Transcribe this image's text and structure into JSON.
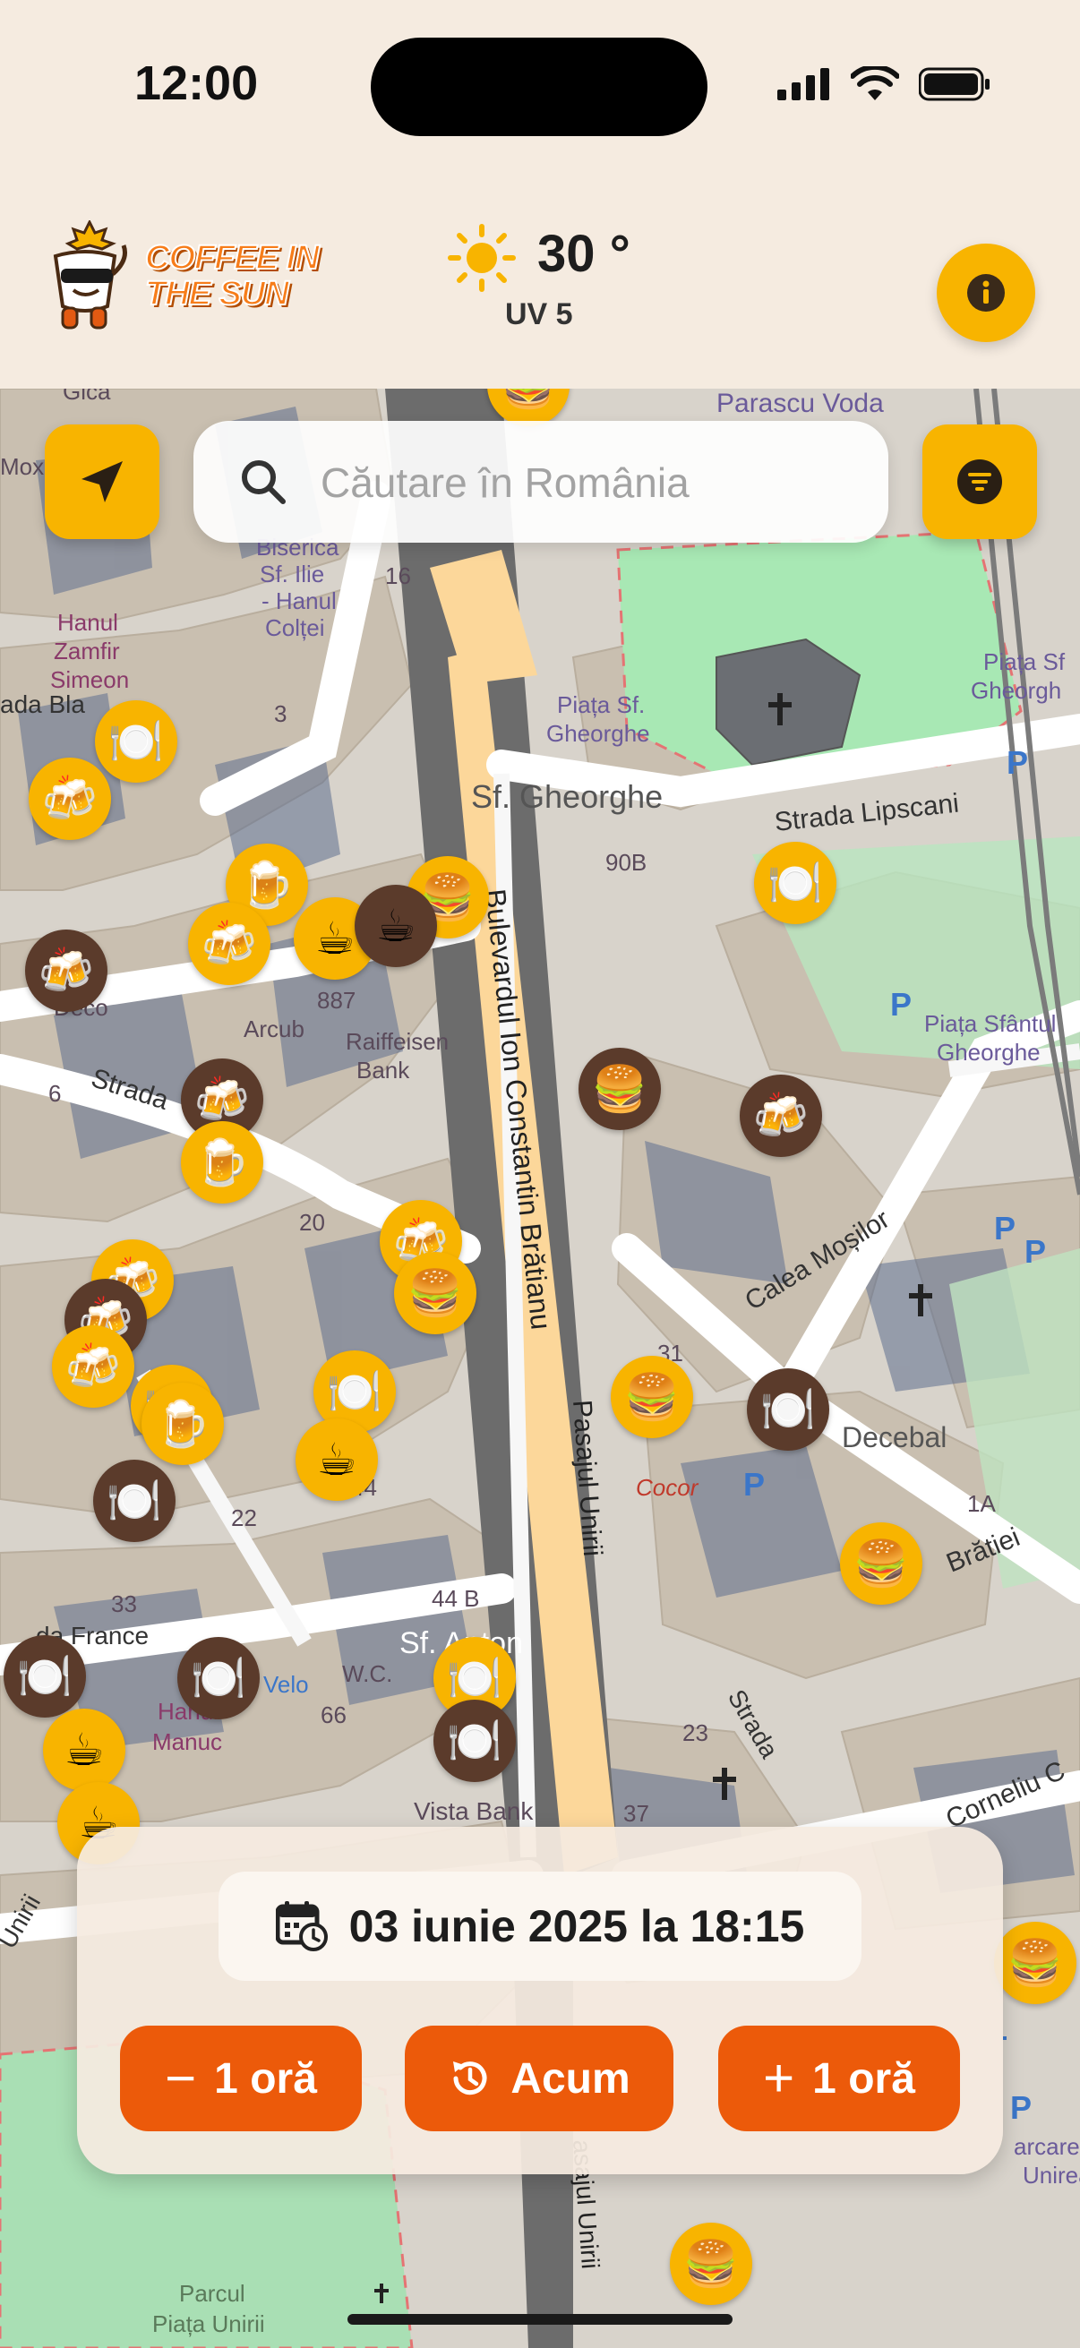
{
  "status_bar": {
    "time": "12:00"
  },
  "header": {
    "logo_line1": "COFFEE IN",
    "logo_line2": "THE SUN",
    "temperature": "30 °",
    "uv": "UV 5"
  },
  "search": {
    "placeholder": "Căutare în România"
  },
  "map_labels": {
    "biserica": [
      "Biserica",
      "Sf. Ilie",
      "- Hanul",
      "Colței"
    ],
    "hanul": [
      "Hanul",
      "Zamfir",
      "Simeon"
    ],
    "piata_sf_gheorghe": [
      "Piața Sf.",
      "Gheorghe"
    ],
    "sf_gheorghe": "Sf. Gheorghe",
    "strada_lipscani": "Strada Lipscani",
    "piata_sf_right": [
      "Piața Sf",
      "Gheorgh"
    ],
    "piata_sfantul": [
      "Piața Sfântul",
      "Gheorghe"
    ],
    "bulevardul": "Bulevardul Ion Constantin Brătianu",
    "raiffeisen": [
      "Raiffeisen",
      "Bank"
    ],
    "deco": "Deco",
    "arcub": "Arcub",
    "strada": "Strada",
    "calea_mosilor": "Calea Moșilor",
    "decebal": "Decebal",
    "cocor": "Cocor",
    "pasajul_unirii": "Pasajul Unirii",
    "bratiei": "Brătiei",
    "sf_anton": "Sf. Anton",
    "hanul_manuc": [
      "Hanul",
      "Manuc"
    ],
    "vista_bank": "Vista Bank",
    "corneliu": "Corneliu C",
    "strada_blanari": "ada Bla",
    "strada_franceza": "da France",
    "unirii_left": "Unirii",
    "piata_unirea": [
      "arcare",
      "Unirea"
    ],
    "parcul": [
      "Parcul",
      "Piața Unirii"
    ],
    "pasajul_bottom": "asajul Unirii",
    "moxa": "Mox",
    "gica": "Gica",
    "parascu": "Parascu Voda",
    "n90b": "90B",
    "n887": "887",
    "n20": "20",
    "n31": "31",
    "n22": "22",
    "n44": "44",
    "n44b": "44 B",
    "n66": "66",
    "n33": "33",
    "n23": "23",
    "n37": "37",
    "n1a": "1A",
    "n3": "3",
    "n6": "6",
    "n16": "16",
    "wc": "W.C.",
    "velo": "Velo"
  },
  "pins": [
    {
      "icon": "🍔",
      "status": "sun"
    },
    {
      "icon": "🍽️",
      "status": "sun"
    },
    {
      "icon": "🍻",
      "status": "sun"
    },
    {
      "icon": "🍺",
      "status": "sun"
    },
    {
      "icon": "🍔",
      "status": "sun"
    },
    {
      "icon": "☕",
      "status": "sun"
    },
    {
      "icon": "☕",
      "status": "shade"
    },
    {
      "icon": "🍻",
      "status": "sun"
    },
    {
      "icon": "🍻",
      "status": "shade"
    },
    {
      "icon": "🍽️",
      "status": "sun"
    },
    {
      "icon": "🍔",
      "status": "shade"
    },
    {
      "icon": "🍻",
      "status": "shade"
    },
    {
      "icon": "🍻",
      "status": "shade"
    },
    {
      "icon": "🍺",
      "status": "sun"
    },
    {
      "icon": "🍻",
      "status": "sun"
    },
    {
      "icon": "🍔",
      "status": "sun"
    },
    {
      "icon": "🍻",
      "status": "sun"
    },
    {
      "icon": "🍻",
      "status": "shade"
    },
    {
      "icon": "🍻",
      "status": "sun"
    },
    {
      "icon": "🍽️",
      "status": "sun"
    },
    {
      "icon": "🍺",
      "status": "sun"
    },
    {
      "icon": "🍽️",
      "status": "sun"
    },
    {
      "icon": "☕",
      "status": "sun"
    },
    {
      "icon": "🍽️",
      "status": "shade"
    },
    {
      "icon": "🍔",
      "status": "sun"
    },
    {
      "icon": "🍽️",
      "status": "shade"
    },
    {
      "icon": "🍔",
      "status": "sun"
    },
    {
      "icon": "🍽️",
      "status": "shade"
    },
    {
      "icon": "🍽️",
      "status": "shade"
    },
    {
      "icon": "☕",
      "status": "sun"
    },
    {
      "icon": "🍽️",
      "status": "sun"
    },
    {
      "icon": "🍽️",
      "status": "shade"
    },
    {
      "icon": "🍔",
      "status": "sun"
    },
    {
      "icon": "🍔",
      "status": "sun"
    },
    {
      "icon": "☕",
      "status": "sun"
    }
  ],
  "time_panel": {
    "date": "03 iunie 2025 la 18:15",
    "minus_glyph": "−",
    "minus_label": "1 oră",
    "now_label": "Acum",
    "plus_glyph": "+",
    "plus_label": "1 oră"
  },
  "colors": {
    "accent": "#f8b400",
    "button": "#ec5a0a",
    "shade_pin": "#5b3b2b",
    "background": "#f5ebe0"
  }
}
